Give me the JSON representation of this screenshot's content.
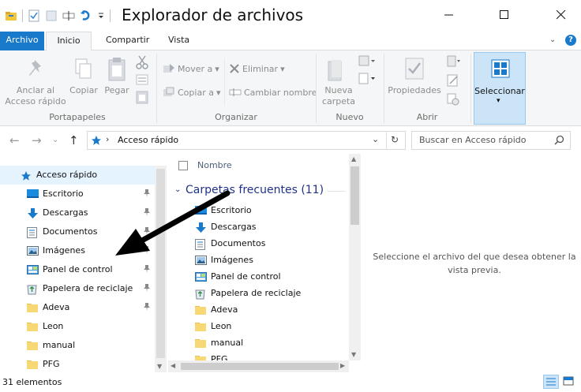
{
  "window": {
    "title": "Explorador de archivos"
  },
  "ribbon": {
    "tabs": [
      "Archivo",
      "Inicio",
      "Compartir",
      "Vista"
    ],
    "groups": {
      "portapapeles": {
        "label": "Portapapeles",
        "pin_label_1": "Anclar al",
        "pin_label_2": "Acceso rápido",
        "copy": "Copiar",
        "paste": "Pegar"
      },
      "organizar": {
        "label": "Organizar",
        "move": "Mover a",
        "copy_to": "Copiar a",
        "delete": "Eliminar",
        "rename": "Cambiar nombre"
      },
      "nuevo": {
        "label": "Nuevo",
        "new_folder_1": "Nueva",
        "new_folder_2": "carpeta"
      },
      "abrir": {
        "label": "Abrir",
        "properties": "Propiedades"
      },
      "seleccionar": {
        "label": "Seleccionar"
      }
    }
  },
  "address": {
    "path": "Acceso rápido",
    "search_placeholder": "Buscar en Acceso rápido"
  },
  "nav_pane": {
    "items": [
      {
        "label": "Acceso rápido",
        "icon": "star-icon",
        "pinned": false
      },
      {
        "label": "Escritorio",
        "icon": "desktop-icon",
        "pinned": true
      },
      {
        "label": "Descargas",
        "icon": "download-icon",
        "pinned": true
      },
      {
        "label": "Documentos",
        "icon": "documents-icon",
        "pinned": true
      },
      {
        "label": "Imágenes",
        "icon": "pictures-icon",
        "pinned": true
      },
      {
        "label": "Panel de control",
        "icon": "control-panel-icon",
        "pinned": true
      },
      {
        "label": "Papelera de reciclaje",
        "icon": "recycle-bin-icon",
        "pinned": true
      },
      {
        "label": "Adeva",
        "icon": "folder-icon",
        "pinned": true
      },
      {
        "label": "Leon",
        "icon": "folder-icon",
        "pinned": false
      },
      {
        "label": "manual",
        "icon": "folder-icon",
        "pinned": false
      },
      {
        "label": "PFG",
        "icon": "folder-icon",
        "pinned": false
      }
    ]
  },
  "content": {
    "column_header": "Nombre",
    "group_title": "Carpetas frecuentes (11)",
    "items": [
      {
        "label": "Escritorio",
        "icon": "desktop-icon"
      },
      {
        "label": "Descargas",
        "icon": "download-icon"
      },
      {
        "label": "Documentos",
        "icon": "documents-icon"
      },
      {
        "label": "Imágenes",
        "icon": "pictures-icon"
      },
      {
        "label": "Panel de control",
        "icon": "control-panel-icon"
      },
      {
        "label": "Papelera de reciclaje",
        "icon": "recycle-bin-icon"
      },
      {
        "label": "Adeva",
        "icon": "folder-icon"
      },
      {
        "label": "Leon",
        "icon": "folder-icon"
      },
      {
        "label": "manual",
        "icon": "folder-icon"
      },
      {
        "label": "PFG",
        "icon": "folder-icon"
      }
    ]
  },
  "preview": {
    "line1": "Seleccione el archivo del que desea obtener la",
    "line2": "vista previa."
  },
  "status": {
    "count": "31 elementos"
  },
  "colors": {
    "accent": "#1979ca",
    "selection": "#e5f3ff",
    "group_title": "#1e3287"
  }
}
